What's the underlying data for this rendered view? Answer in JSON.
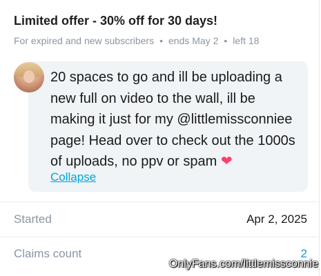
{
  "offer": {
    "title": "Limited offer - 30% off for 30 days!",
    "audience": "For expired and new subscribers",
    "separator": "•",
    "ends": "ends May 2",
    "left": "left 18"
  },
  "message": {
    "text": "20 spaces to go and ill be uploading a new full on video to the wall, ill be making it just for my @littlemissconniee page! Head over to check out the 1000s of uploads, no ppv or spam",
    "emoji": "❤",
    "collapse_label": "Collapse"
  },
  "stats": {
    "started_label": "Started",
    "started_value": "Apr 2, 2025",
    "claims_label": "Claims count",
    "claims_value": "2"
  },
  "watermark": "OnlyFans.com/littlemissconnie",
  "colors": {
    "accent": "#00a4d6",
    "muted": "#8a96a3",
    "bubble": "#f0f4f6",
    "heart": "#ff3e6c"
  },
  "icons": {
    "avatar": "profile-photo"
  }
}
